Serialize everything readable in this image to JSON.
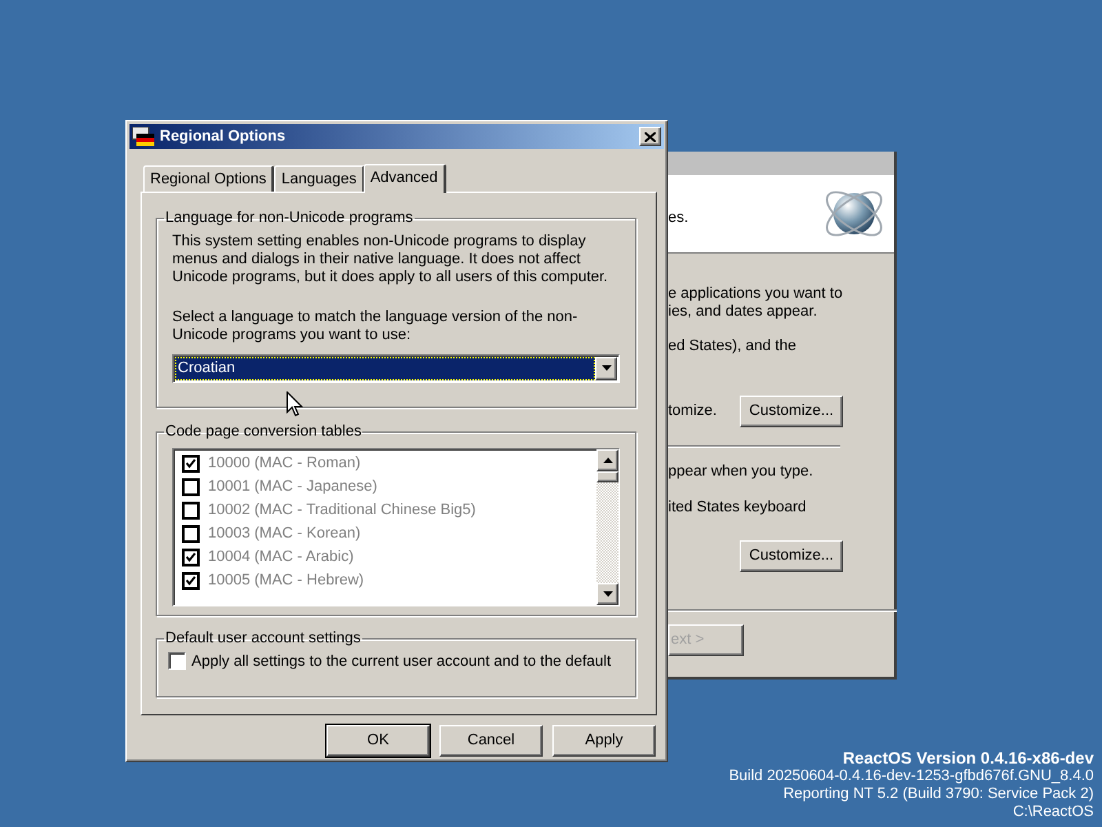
{
  "background_window": {
    "header_text": "es.",
    "region_lines": [
      "e applications you want to",
      "ies, and dates appear."
    ],
    "region_line_2": "ed States), and the",
    "customize_label": "tomize.",
    "customize_button": "Customize...",
    "input_lines": [
      "ppear when you type.",
      "ited States keyboard"
    ],
    "input_button": "Customize...",
    "next_button": {
      "label": "ext >",
      "disabled": true
    }
  },
  "dialog": {
    "title": "Regional Options",
    "tabs": [
      {
        "label": "Regional Options",
        "selected": false
      },
      {
        "label": "Languages",
        "selected": false
      },
      {
        "label": "Advanced",
        "selected": true
      }
    ],
    "non_unicode_group": {
      "title": "Language for non-Unicode programs",
      "description": "This system setting enables non-Unicode programs to display menus and dialogs in their native language. It does not affect Unicode programs, but it does apply to all users of this computer.",
      "prompt": "Select a language to match the language version of the non-Unicode programs you want to use:",
      "dropdown": {
        "value": "Croatian",
        "focused": true
      }
    },
    "code_page_group": {
      "title": "Code page conversion tables",
      "disabled": true,
      "items": [
        {
          "label": "10000 (MAC - Roman)",
          "checked": true
        },
        {
          "label": "10001 (MAC - Japanese)",
          "checked": false
        },
        {
          "label": "10002 (MAC - Traditional Chinese Big5)",
          "checked": false
        },
        {
          "label": "10003 (MAC - Korean)",
          "checked": false
        },
        {
          "label": "10004 (MAC - Arabic)",
          "checked": true
        },
        {
          "label": "10005 (MAC - Hebrew)",
          "checked": true
        }
      ]
    },
    "default_user_group": {
      "title": "Default user account settings",
      "checkbox": {
        "label": "Apply all settings to the current user account and to the default",
        "checked": false
      }
    },
    "buttons": [
      {
        "label": "OK",
        "default": true
      },
      {
        "label": "Cancel",
        "default": false
      },
      {
        "label": "Apply",
        "default": false
      }
    ]
  },
  "version_info": {
    "title": "ReactOS Version 0.4.16-x86-dev",
    "lines": [
      "Build 20250604-0.4.16-dev-1253-gfbd676f.GNU_8.4.0",
      "Reporting NT 5.2 (Build 3790: Service Pack 2)",
      "C:\\ReactOS"
    ]
  }
}
